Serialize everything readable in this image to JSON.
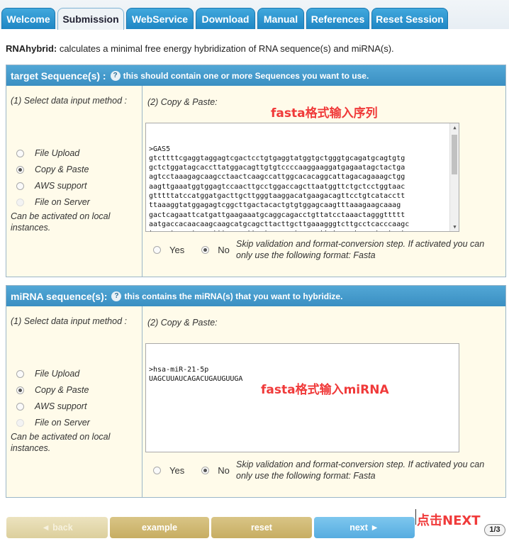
{
  "tabs": [
    {
      "label": "Welcome"
    },
    {
      "label": "Submission"
    },
    {
      "label": "WebService"
    },
    {
      "label": "Download"
    },
    {
      "label": "Manual"
    },
    {
      "label": "References"
    },
    {
      "label": "Reset Session"
    }
  ],
  "active_tab": "Submission",
  "intro": {
    "name": "RNAhybrid:",
    "text": " calculates a minimal free energy hybridization of RNA sequence(s) and miRNA(s)."
  },
  "target": {
    "title": "target Sequence(s) :",
    "help": "this should contain one or more Sequences you want to use.",
    "method_label": "(1) Select data input method :",
    "paste_label": "(2) Copy & Paste:",
    "options": [
      "File Upload",
      "Copy & Paste",
      "AWS support",
      "File on Server"
    ],
    "selected": "Copy & Paste",
    "note": "Can be activated on local instances.",
    "annotation": "fasta格式输入序列",
    "sequence": ">GAS5\ngtcttttcgaggtaggagtcgactcctgtgaggtatggtgctgggtgcagatgcagtgtg\ngctctggatagcaccttatggacagttgtgtccccaaggaaggatgagaatagctactga\nagtcctaaagagcaagcctaactcaagccattggcacacaggcattagacagaaagctgg\naagttgaaatggtggagtccaacttgcctggaccagcttaatggttctgctcctggtaac\ngtttttatccatggatgacttgcttgggtaaggacatgaagacagttcctgtcatacctt\nttaaaggtatggagagtcggcttgactacactgtgtggagcaagtttaaagaagcaaag\ngactcagaattcatgattgaagaaatgcaggcagacctgttatcctaaactagggttttt\naatgaccacaacaagcaagcatgcagcttacttgcttgaaagggtcttgcctcacccaagc\ntagagtgcagtggcctttgaagcttactacagcctcaaacttctgggctcaagtgatcct",
    "yes_label": "Yes",
    "no_label": "No",
    "skip_text": "Skip validation and format-conversion step. If activated you can only use the following format: Fasta"
  },
  "mirna": {
    "title": "miRNA sequence(s):",
    "help": "this contains the miRNA(s) that you want to hybridize.",
    "method_label": "(1) Select data input method :",
    "paste_label": "(2) Copy & Paste:",
    "options": [
      "File Upload",
      "Copy & Paste",
      "AWS support",
      "File on Server"
    ],
    "selected": "Copy & Paste",
    "note": "Can be activated on local instances.",
    "annotation": "fasta格式输入miRNA",
    "sequence": ">hsa-miR-21-5p\nUAGCUUAUCAGACUGAUGUUGA",
    "yes_label": "Yes",
    "no_label": "No",
    "skip_text": "Skip validation and format-conversion step. If activated you can only use the following format: Fasta"
  },
  "buttons": {
    "back": "◄ back",
    "example": "example",
    "reset": "reset",
    "next": "next ►"
  },
  "next_annotation": "点击NEXT",
  "page_indicator": "1/3",
  "colors": {
    "tab_blue": "#2a93cf",
    "panel_header": "#4a9fd0",
    "panel_bg": "#fffbea",
    "annotation_red": "#f03a3a"
  }
}
